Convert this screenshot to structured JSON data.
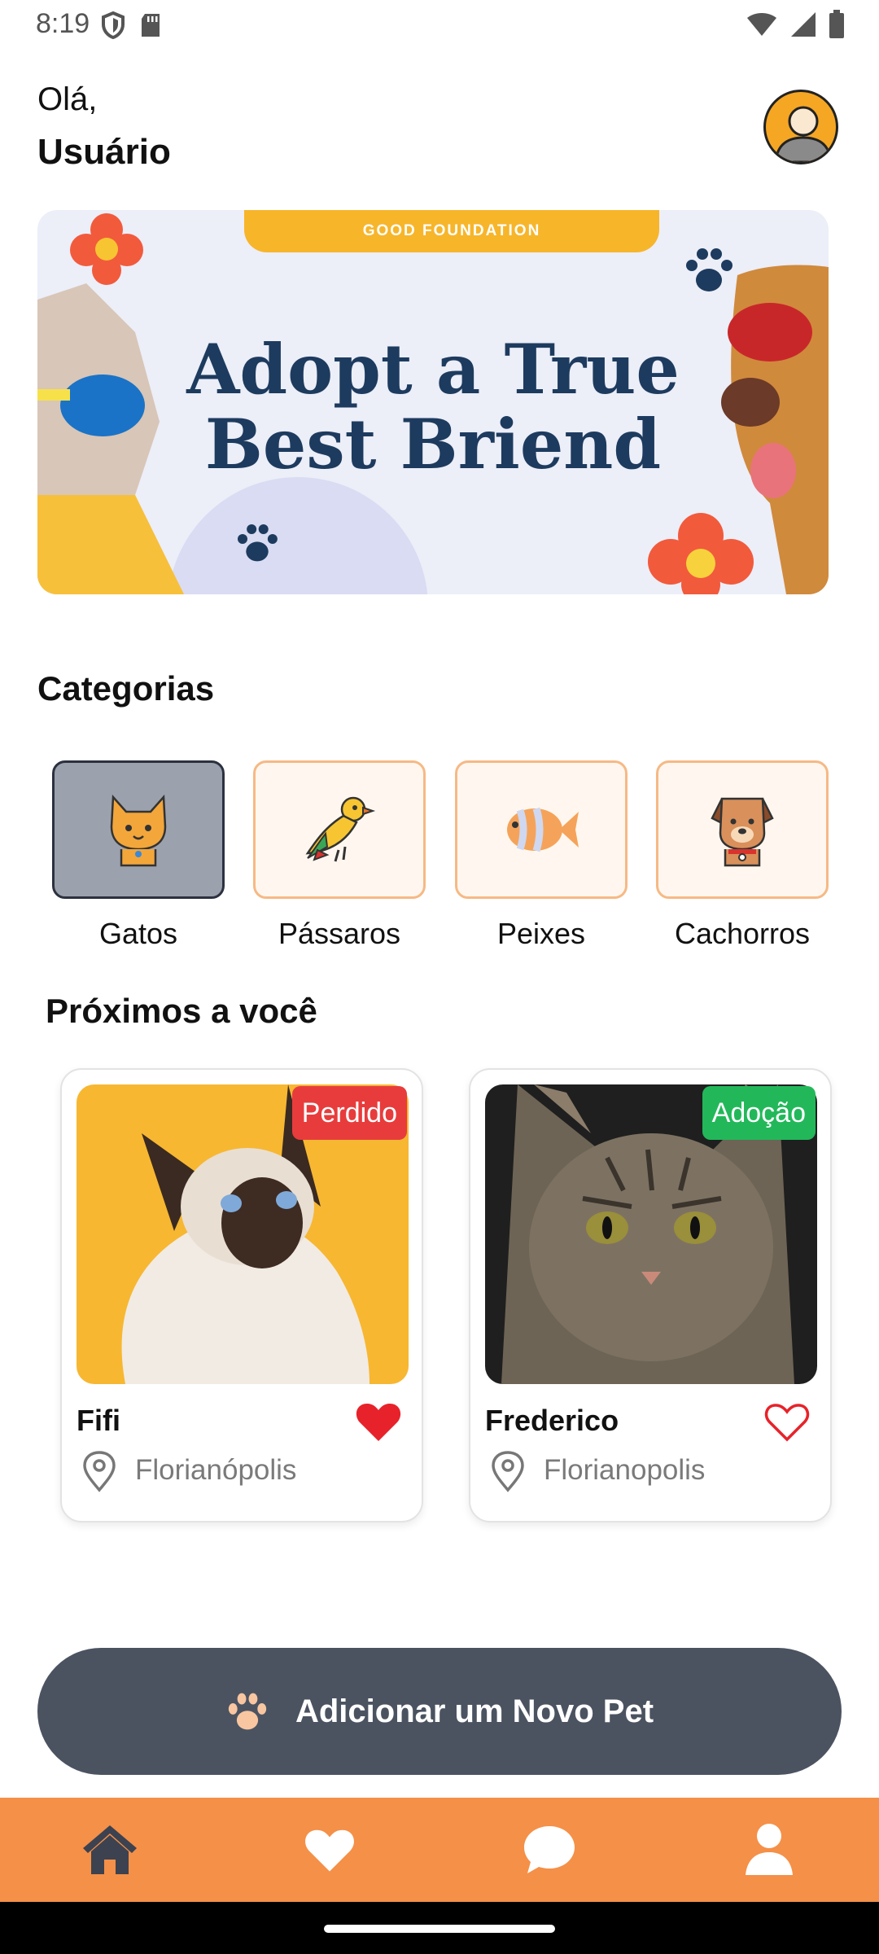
{
  "status_bar": {
    "time": "8:19",
    "left_icons": [
      "shield-icon",
      "sd-card-icon"
    ],
    "right_icons": [
      "wifi-icon",
      "signal-icon",
      "battery-icon"
    ]
  },
  "header": {
    "greeting": "Olá,",
    "username": "Usuário",
    "avatar_icon": "user-avatar-icon"
  },
  "banner": {
    "tag": "GOOD FOUNDATION",
    "title_line1": "Adopt a True",
    "title_line2": "Best Briend"
  },
  "categories": {
    "title": "Categorias",
    "items": [
      {
        "label": "Gatos",
        "icon": "cat-icon",
        "selected": true
      },
      {
        "label": "Pássaros",
        "icon": "bird-icon",
        "selected": false
      },
      {
        "label": "Peixes",
        "icon": "fish-icon",
        "selected": false
      },
      {
        "label": "Cachorros",
        "icon": "dog-icon",
        "selected": false
      }
    ]
  },
  "nearby": {
    "title": "Próximos a você",
    "pets": [
      {
        "name": "Fifi",
        "badge": "Perdido",
        "badge_color": "#e83c3c",
        "location": "Florianópolis",
        "favorited": true
      },
      {
        "name": "Frederico",
        "badge": "Adoção",
        "badge_color": "#22b85a",
        "location": "Florianopolis",
        "favorited": false
      }
    ]
  },
  "add_button": {
    "label": "Adicionar um Novo Pet",
    "icon": "paw-icon"
  },
  "bottom_nav": {
    "items": [
      "home-icon",
      "heart-icon",
      "chat-icon",
      "profile-icon"
    ],
    "active": "home-icon",
    "color": "#f59048"
  },
  "colors": {
    "accent": "#f59048",
    "button": "#4b5361",
    "heart": "#e8222a"
  }
}
